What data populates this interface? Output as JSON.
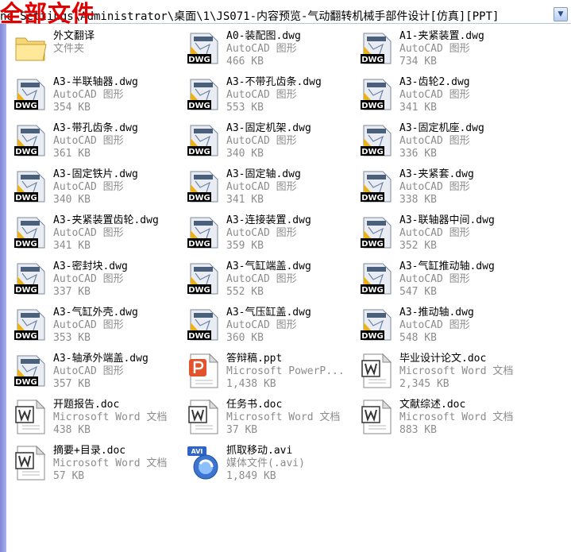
{
  "address_bar": {
    "path": "nd Settings\\Administrator\\桌面\\1\\JS071-内容预览-气动翻转机械手部件设计[仿真][PPT]"
  },
  "overlay_title": "全部文件",
  "files": [
    {
      "name": "外文翻译",
      "type": "文件夹",
      "size": "",
      "icon": "folder-icon"
    },
    {
      "name": "A0-装配图.dwg",
      "type": "AutoCAD 图形",
      "size": "466 KB",
      "icon": "dwg-icon"
    },
    {
      "name": "A1-夹紧装置.dwg",
      "type": "AutoCAD 图形",
      "size": "734 KB",
      "icon": "dwg-icon"
    },
    {
      "name": "A3-半联轴器.dwg",
      "type": "AutoCAD 图形",
      "size": "354 KB",
      "icon": "dwg-icon"
    },
    {
      "name": "A3-不带孔齿条.dwg",
      "type": "AutoCAD 图形",
      "size": "553 KB",
      "icon": "dwg-icon"
    },
    {
      "name": "A3-齿轮2.dwg",
      "type": "AutoCAD 图形",
      "size": "341 KB",
      "icon": "dwg-icon"
    },
    {
      "name": "A3-带孔齿条.dwg",
      "type": "AutoCAD 图形",
      "size": "361 KB",
      "icon": "dwg-icon"
    },
    {
      "name": "A3-固定机架.dwg",
      "type": "AutoCAD 图形",
      "size": "340 KB",
      "icon": "dwg-icon"
    },
    {
      "name": "A3-固定机座.dwg",
      "type": "AutoCAD 图形",
      "size": "336 KB",
      "icon": "dwg-icon"
    },
    {
      "name": "A3-固定铁片.dwg",
      "type": "AutoCAD 图形",
      "size": "340 KB",
      "icon": "dwg-icon"
    },
    {
      "name": "A3-固定轴.dwg",
      "type": "AutoCAD 图形",
      "size": "341 KB",
      "icon": "dwg-icon"
    },
    {
      "name": "A3-夹紧套.dwg",
      "type": "AutoCAD 图形",
      "size": "338 KB",
      "icon": "dwg-icon"
    },
    {
      "name": "A3-夹紧装置齿轮.dwg",
      "type": "AutoCAD 图形",
      "size": "341 KB",
      "icon": "dwg-icon"
    },
    {
      "name": "A3-连接装置.dwg",
      "type": "AutoCAD 图形",
      "size": "359 KB",
      "icon": "dwg-icon"
    },
    {
      "name": "A3-联轴器中间.dwg",
      "type": "AutoCAD 图形",
      "size": "352 KB",
      "icon": "dwg-icon"
    },
    {
      "name": "A3-密封块.dwg",
      "type": "AutoCAD 图形",
      "size": "337 KB",
      "icon": "dwg-icon"
    },
    {
      "name": "A3-气缸端盖.dwg",
      "type": "AutoCAD 图形",
      "size": "552 KB",
      "icon": "dwg-icon"
    },
    {
      "name": "A3-气缸推动轴.dwg",
      "type": "AutoCAD 图形",
      "size": "547 KB",
      "icon": "dwg-icon"
    },
    {
      "name": "A3-气缸外壳.dwg",
      "type": "AutoCAD 图形",
      "size": "353 KB",
      "icon": "dwg-icon"
    },
    {
      "name": "A3-气压缸盖.dwg",
      "type": "AutoCAD 图形",
      "size": "360 KB",
      "icon": "dwg-icon"
    },
    {
      "name": "A3-推动轴.dwg",
      "type": "AutoCAD 图形",
      "size": "548 KB",
      "icon": "dwg-icon"
    },
    {
      "name": "A3-轴承外端盖.dwg",
      "type": "AutoCAD 图形",
      "size": "357 KB",
      "icon": "dwg-icon"
    },
    {
      "name": "答辩稿.ppt",
      "type": "Microsoft PowerP...",
      "size": "1,438 KB",
      "icon": "ppt-icon"
    },
    {
      "name": "毕业设计论文.doc",
      "type": "Microsoft Word 文档",
      "size": "2,345 KB",
      "icon": "doc-icon"
    },
    {
      "name": "开题报告.doc",
      "type": "Microsoft Word 文档",
      "size": "438 KB",
      "icon": "doc-icon"
    },
    {
      "name": "任务书.doc",
      "type": "Microsoft Word 文档",
      "size": "37 KB",
      "icon": "doc-icon"
    },
    {
      "name": "文献综述.doc",
      "type": "Microsoft Word 文档",
      "size": "883 KB",
      "icon": "doc-icon"
    },
    {
      "name": "摘要+目录.doc",
      "type": "Microsoft Word 文档",
      "size": "57 KB",
      "icon": "doc-icon"
    },
    {
      "name": "抓取移动.avi",
      "type": "媒体文件(.avi)",
      "size": "1,849 KB",
      "icon": "avi-icon"
    }
  ],
  "icon_labels": {
    "dwg": "DWG",
    "avi": "AVI"
  }
}
